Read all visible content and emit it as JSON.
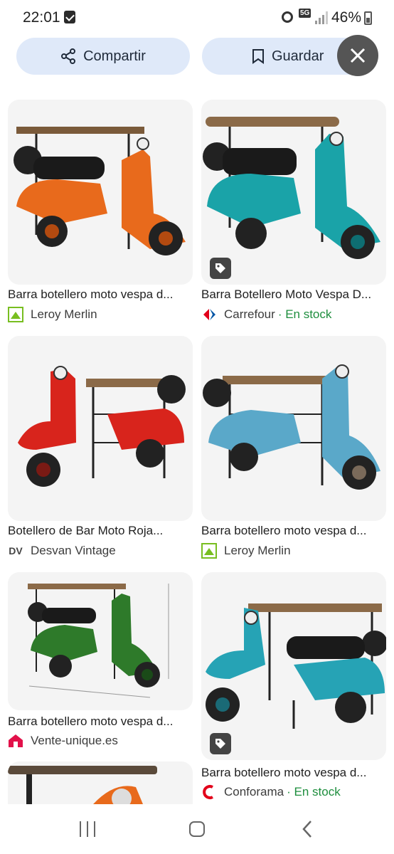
{
  "status_bar": {
    "time": "22:01",
    "network": "5G",
    "battery": "46%"
  },
  "actions": {
    "share_label": "Compartir",
    "save_label": "Guardar"
  },
  "results": [
    {
      "title": "Barra botellero moto vespa d...",
      "source": "Leroy Merlin",
      "stock": "",
      "color": "#e86a1c",
      "logo": "leroy-merlin-logo",
      "tag": false
    },
    {
      "title": "Barra Botellero Moto Vespa D...",
      "source": "Carrefour",
      "stock": " · En stock",
      "color": "#1aa3a8",
      "logo": "carrefour-logo",
      "tag": true
    },
    {
      "title": "Botellero de Bar Moto Roja...",
      "source": "Desvan Vintage",
      "stock": "",
      "color": "#d8241c",
      "logo": "desvan-vintage-logo",
      "logo_text": "DV",
      "tag": false
    },
    {
      "title": "Barra botellero moto vespa d...",
      "source": "Leroy Merlin",
      "stock": "",
      "color": "#5aa8c9",
      "logo": "leroy-merlin-logo",
      "tag": false
    },
    {
      "title": "Barra botellero moto vespa d...",
      "source": "Vente-unique.es",
      "stock": "",
      "color": "#2e7a2a",
      "logo": "vente-unique-logo",
      "tag": false
    },
    {
      "title": "Barra botellero moto vespa d...",
      "source": "Conforama",
      "stock": " · En stock",
      "color": "#26a3b5",
      "logo": "conforama-logo",
      "tag": true
    },
    {
      "title": "",
      "source": "",
      "stock": "",
      "color": "#e86a1c",
      "logo": "",
      "tag": false
    }
  ]
}
